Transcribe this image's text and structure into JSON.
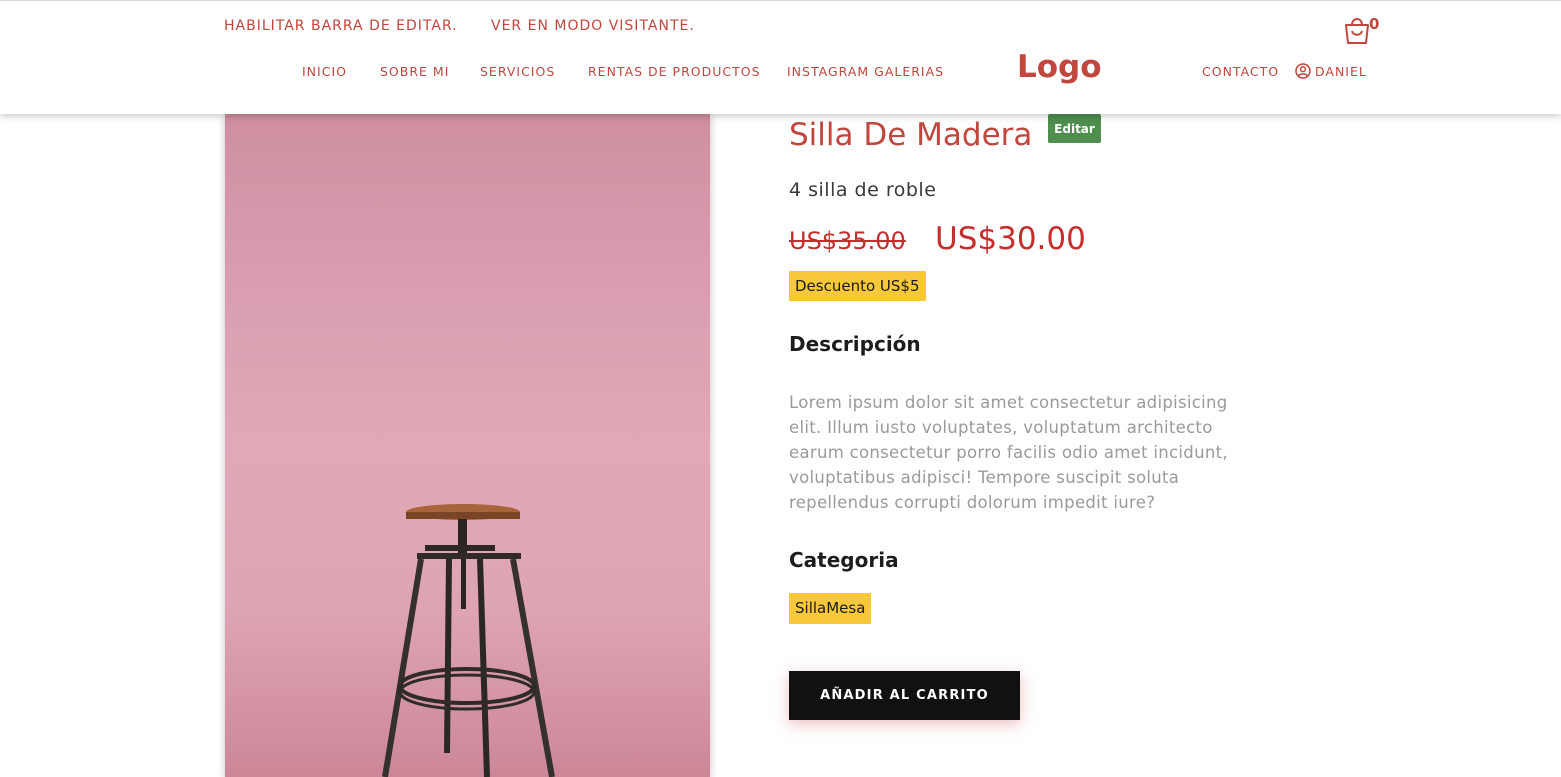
{
  "admin_bar": {
    "enable_edit": "HABILITAR BARRA DE EDITAR.",
    "visitor_mode": "VER EN MODO VISITANTE."
  },
  "nav": {
    "items": [
      {
        "label": "INICIO"
      },
      {
        "label": "SOBRE MI"
      },
      {
        "label": "SERVICIOS"
      },
      {
        "label": "RENTAS DE PRODUCTOS"
      },
      {
        "label": "INSTAGRAM GALERIAS"
      }
    ],
    "logo": "Logo",
    "contact": "CONTACTO",
    "user": "DANIEL",
    "cart_count": "0"
  },
  "product": {
    "title": "Silla De Madera",
    "edit_label": "Editar",
    "subtitle": "4 silla de roble",
    "old_price": "US$35.00",
    "new_price": "US$30.00",
    "discount": "Descuento US$5",
    "description_heading": "Descripción",
    "description": "Lorem ipsum dolor sit amet consectetur adipisicing elit. Illum iusto voluptates, voluptatum architecto earum consectetur porro facilis odio amet incidunt, voluptatibus adipisci! Tempore suscipit soluta repellendus corrupti dolorum impedit iure?",
    "category_heading": "Categoria",
    "category": "SillaMesa",
    "add_to_cart": "AÑADIR AL CARRITO"
  },
  "colors": {
    "accent": "#c0463e",
    "price": "#c62d2d",
    "tag": "#f7c73c",
    "edit_button": "#4f8e4f",
    "image_background": "#e1a9b7"
  },
  "icons": {
    "cart": "shopping-bag-icon",
    "user": "user-circle-icon"
  }
}
